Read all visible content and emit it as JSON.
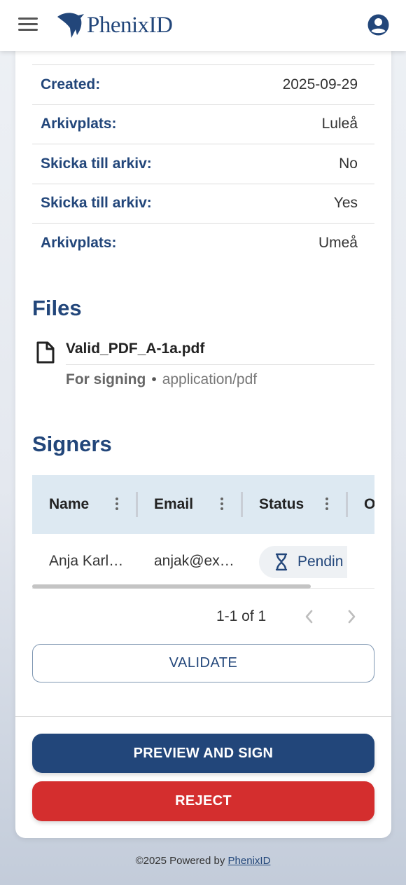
{
  "header": {
    "brand": "PhenixID",
    "menu_icon": "hamburger-menu-icon",
    "account_icon": "account-circle-icon"
  },
  "metadata": {
    "rows": [
      {
        "label": "Created:",
        "value": "2025-09-29"
      },
      {
        "label": "Arkivplats:",
        "value": "Luleå"
      },
      {
        "label": "Skicka till arkiv:",
        "value": "No"
      },
      {
        "label": "Skicka till arkiv:",
        "value": "Yes"
      },
      {
        "label": "Arkivplats:",
        "value": "Umeå"
      }
    ]
  },
  "files": {
    "title": "Files",
    "items": [
      {
        "name": "Valid_PDF_A-1a.pdf",
        "purpose": "For signing",
        "separator": "•",
        "mime": "application/pdf",
        "icon": "file-icon"
      }
    ]
  },
  "signers": {
    "title": "Signers",
    "columns": [
      "Name",
      "Email",
      "Status",
      "O"
    ],
    "rows": [
      {
        "name": "Anja Karl…",
        "email": "anjak@ex…",
        "status": "Pendin",
        "status_icon": "hourglass-icon"
      }
    ],
    "pagination": {
      "text": "1-1 of 1"
    }
  },
  "actions": {
    "validate": "VALIDATE",
    "preview_sign": "PREVIEW AND SIGN",
    "reject": "REJECT"
  },
  "footer": {
    "prefix": "©2025 Powered by",
    "link": "PhenixID"
  },
  "colors": {
    "brand": "#22467a",
    "danger": "#d42e2e",
    "grid_header": "#dde9f2"
  }
}
